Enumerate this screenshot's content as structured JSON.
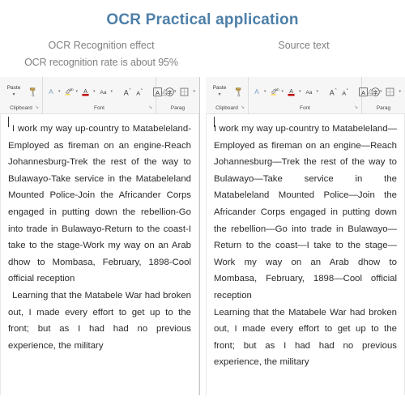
{
  "header": {
    "title": "OCR Practical application",
    "left_caption": "OCR Recognition effect",
    "left_subcaption": "OCR recognition rate is about 95%",
    "right_caption": "Source text"
  },
  "colors": {
    "title": "#4d7fa8",
    "caption": "#808080",
    "body_text": "#2b2b2b",
    "ribbon_bg": "#f6f6f6",
    "ribbon_border": "#e2e2e2",
    "highlight_yellow": "#ffd966",
    "font_color_red": "#c00000"
  },
  "ribbon": {
    "groups": [
      {
        "name": "clipboard",
        "label": "Clipboard",
        "dialog_launcher": "↘",
        "items": [
          {
            "name": "paste-button",
            "label": "Paste",
            "caret": "▾"
          },
          {
            "name": "format-painter-icon",
            "label": "Format Painter"
          }
        ]
      },
      {
        "name": "font",
        "label": "Font",
        "dialog_launcher": "↘",
        "items": [
          {
            "name": "text-effects-icon",
            "label": "A",
            "caret": "▾"
          },
          {
            "name": "text-highlight-color-icon",
            "label": "ab",
            "caret": "▾"
          },
          {
            "name": "font-color-icon",
            "label": "A",
            "caret": "▾"
          },
          {
            "name": "change-case-icon",
            "label": "Aa",
            "caret": "▾"
          },
          {
            "name": "grow-font-icon",
            "label": "A"
          },
          {
            "name": "shrink-font-icon",
            "label": "A"
          },
          {
            "name": "character-border-icon",
            "label": "A"
          },
          {
            "name": "enclose-characters-icon",
            "label": "字"
          }
        ]
      },
      {
        "name": "paragraph",
        "label": "Parag",
        "items": [
          {
            "name": "shading-icon",
            "label": "Shading",
            "caret": "▾"
          },
          {
            "name": "borders-icon",
            "label": "Borders",
            "caret": "▾"
          }
        ]
      }
    ]
  },
  "panels": {
    "left": {
      "name": "ocr-result-panel",
      "paragraphs": [
        "I work my way up-country to Matabeleland-Employed as fireman on an engine-Reach Johannesburg-Trek the rest of the way to Bulawayo-Take service in the Matabeleland Mounted Police-Join the Africander Corps engaged in putting down the rebellion-Go into trade in Bulawayo-Return to the coast-I take to the stage-Work my way on an Arab dhow to Mombasa, February, 1898-Cool official reception",
        "Learning that the Matabele War had broken out, I made every effort to get up to the front; but as I had had no previous experience, the military"
      ]
    },
    "right": {
      "name": "source-text-panel",
      "paragraphs": [
        "I work my way up-country to Matabeleland—Employed as fireman on an engine—Reach Johannesburg—Trek the rest of the way to Bulawayo—Take service in the Matabeleland Mounted Police—Join the Africander Corps engaged in putting down the rebellion—Go into trade in Bulawayo—Return to the coast—I take to the stage—Work my way on an Arab dhow to Mombasa, February, 1898—Cool official reception",
        "Learning that the Matabele War had broken out, I made every effort to get up to the front; but as I had had no previous experience, the military"
      ]
    }
  }
}
